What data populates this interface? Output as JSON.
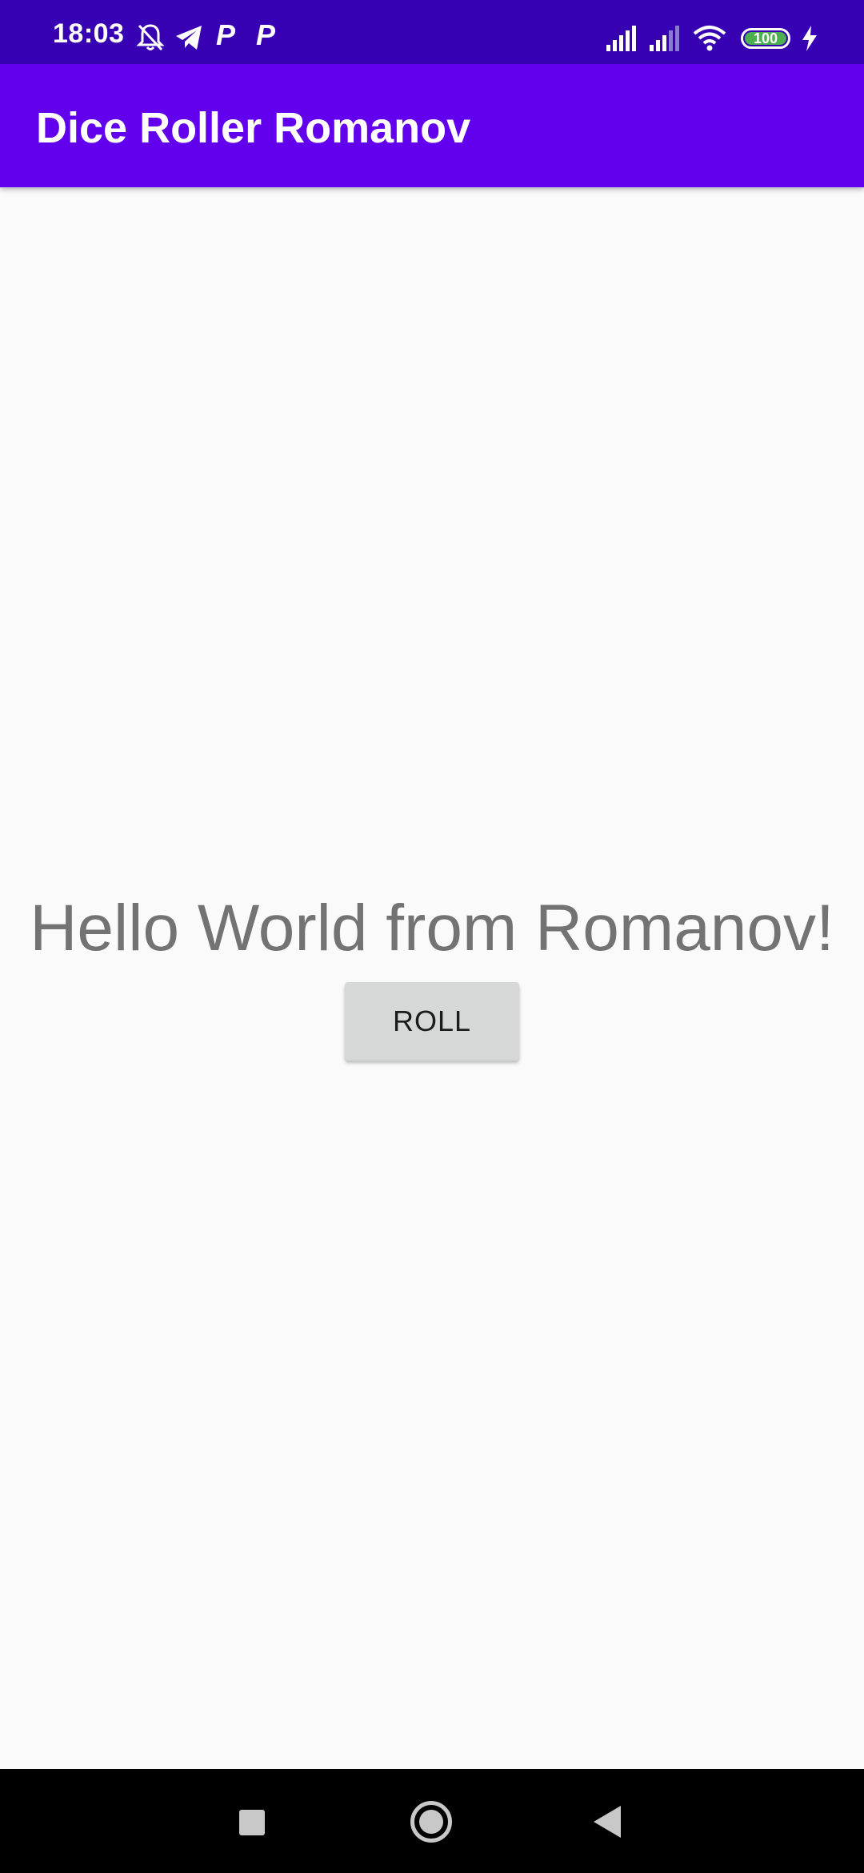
{
  "status_bar": {
    "time": "18:03",
    "battery": "100",
    "icons": [
      "muted-bell-icon",
      "telegram-icon",
      "p-icon",
      "p-icon",
      "signal-icon",
      "signal-icon",
      "wifi-icon",
      "battery-icon",
      "charging-icon"
    ],
    "p_glyph": "P"
  },
  "app_bar": {
    "title": "Dice Roller Romanov",
    "color": "#6200ee"
  },
  "main": {
    "greeting": "Hello World from Romanov!",
    "roll_label": "ROLL"
  },
  "nav_bar": {
    "buttons": [
      "recents-icon",
      "home-icon",
      "back-icon"
    ]
  }
}
